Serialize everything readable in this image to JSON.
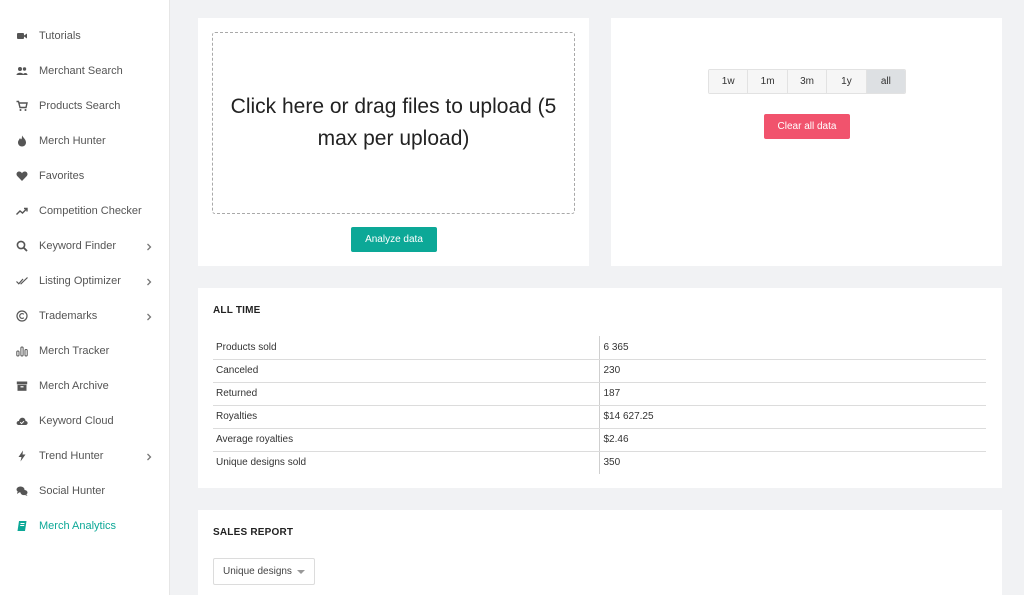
{
  "sidebar": {
    "items": [
      {
        "label": "Tutorials",
        "icon": "video-camera-icon",
        "chevron": false,
        "active": false
      },
      {
        "label": "Merchant Search",
        "icon": "users-icon",
        "chevron": false,
        "active": false
      },
      {
        "label": "Products Search",
        "icon": "cart-icon",
        "chevron": false,
        "active": false
      },
      {
        "label": "Merch Hunter",
        "icon": "flame-icon",
        "chevron": false,
        "active": false
      },
      {
        "label": "Favorites",
        "icon": "heart-icon",
        "chevron": false,
        "active": false
      },
      {
        "label": "Competition Checker",
        "icon": "trend-line-icon",
        "chevron": false,
        "active": false
      },
      {
        "label": "Keyword Finder",
        "icon": "search-icon",
        "chevron": true,
        "active": false
      },
      {
        "label": "Listing Optimizer",
        "icon": "double-check-icon",
        "chevron": true,
        "active": false
      },
      {
        "label": "Trademarks",
        "icon": "copyright-icon",
        "chevron": true,
        "active": false
      },
      {
        "label": "Merch Tracker",
        "icon": "bar-chart-icon",
        "chevron": false,
        "active": false
      },
      {
        "label": "Merch Archive",
        "icon": "archive-box-icon",
        "chevron": false,
        "active": false
      },
      {
        "label": "Keyword Cloud",
        "icon": "cloud-icon",
        "chevron": false,
        "active": false
      },
      {
        "label": "Trend Hunter",
        "icon": "lightning-icon",
        "chevron": true,
        "active": false
      },
      {
        "label": "Social Hunter",
        "icon": "chat-bubbles-icon",
        "chevron": false,
        "active": false
      },
      {
        "label": "Merch Analytics",
        "icon": "book-icon",
        "chevron": false,
        "active": true
      }
    ]
  },
  "upload": {
    "dropzone_text": "Click here or drag files to upload (5 max per upload)",
    "analyze_label": "Analyze data"
  },
  "range": {
    "options": [
      "1w",
      "1m",
      "3m",
      "1y",
      "all"
    ],
    "selected": "all",
    "clear_label": "Clear all data"
  },
  "all_time": {
    "title": "ALL TIME",
    "rows": [
      {
        "label": "Products sold",
        "value": "6 365"
      },
      {
        "label": "Canceled",
        "value": "230"
      },
      {
        "label": "Returned",
        "value": "187"
      },
      {
        "label": "Royalties",
        "value": "$14 627.25"
      },
      {
        "label": "Average royalties",
        "value": "$2.46"
      },
      {
        "label": "Unique designs sold",
        "value": "350"
      }
    ]
  },
  "sales_report": {
    "title": "SALES REPORT",
    "select_value": "Unique designs"
  },
  "colors": {
    "accent": "#0ca897",
    "danger": "#f1536d",
    "selected_range": "#dde0e3"
  }
}
